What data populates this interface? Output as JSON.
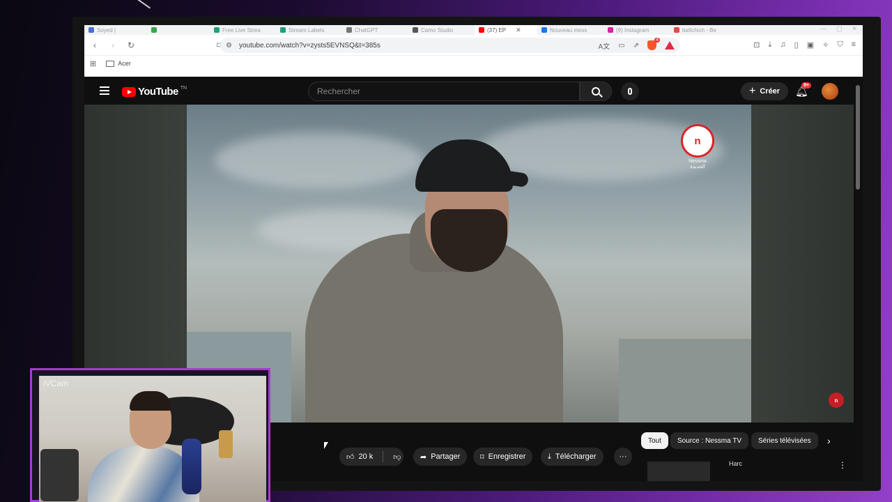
{
  "browser": {
    "tabs": [
      {
        "label": "Soyed |",
        "color": "#4f6dd8"
      },
      {
        "label": "",
        "color": "#3aa44a"
      },
      {
        "label": "Free Live Strea",
        "color": "#1fa07a"
      },
      {
        "label": "Stream Labels",
        "color": "#1fa07a"
      },
      {
        "label": "ChatGPT",
        "color": "#777777"
      },
      {
        "label": "Camo Studio",
        "color": "#555555"
      },
      {
        "label": "(37) EP",
        "color": "#ff0000",
        "active": true
      },
      {
        "label": "Nouveau mess",
        "color": "#1877f2"
      },
      {
        "label": "(9) Instagram",
        "color": "#d6249f"
      },
      {
        "label": "ba9chich - Be",
        "color": "#e24a4a"
      }
    ],
    "url": "youtube.com/watch?v=zysts5EVNSQ&t=385s",
    "bookmarks": [
      "Acer"
    ]
  },
  "youtube": {
    "logo_text": "YouTube",
    "logo_region": "TN",
    "search_placeholder": "Rechercher",
    "create_label": "Créer",
    "notification_count": "9+",
    "channel_watermark": "Nessma",
    "channel_watermark_ar": "الجديدة",
    "likes": "20 k",
    "share_label": "Partager",
    "save_label": "Enregistrer",
    "download_label": "Télécharger",
    "more_label": "···",
    "chips": [
      "Tout",
      "Source : Nessma TV",
      "Séries télévisées"
    ],
    "side_video_title": "Harc"
  },
  "webcam": {
    "label": "iVCam"
  }
}
